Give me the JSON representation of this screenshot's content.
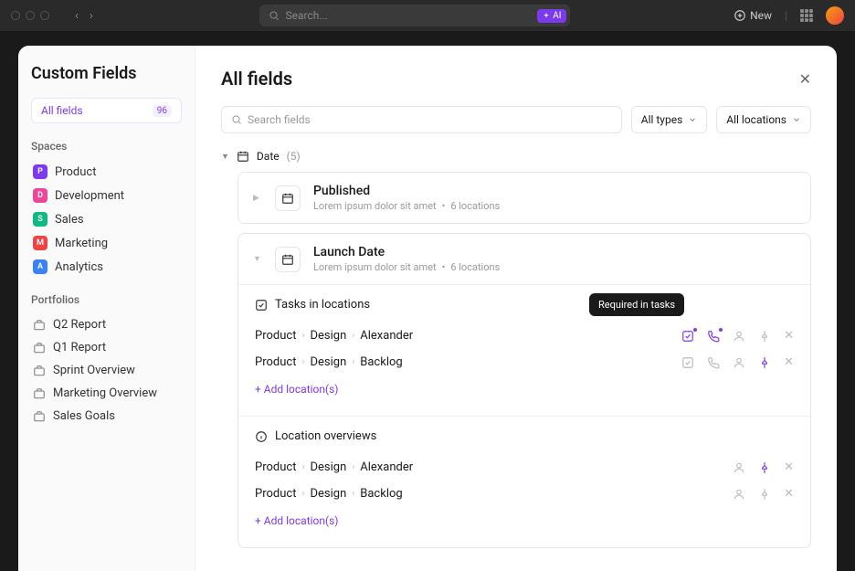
{
  "titlebar": {
    "search_placeholder": "Search...",
    "ai_label": "AI",
    "new_label": "New"
  },
  "sidebar": {
    "title": "Custom Fields",
    "all_fields_label": "All fields",
    "all_fields_count": "96",
    "spaces_label": "Spaces",
    "spaces": [
      {
        "letter": "P",
        "color": "#7c3aed",
        "name": "Product"
      },
      {
        "letter": "D",
        "color": "#ec4899",
        "name": "Development"
      },
      {
        "letter": "S",
        "color": "#10b981",
        "name": "Sales"
      },
      {
        "letter": "M",
        "color": "#ef4444",
        "name": "Marketing"
      },
      {
        "letter": "A",
        "color": "#3b82f6",
        "name": "Analytics"
      }
    ],
    "portfolios_label": "Portfolios",
    "portfolios": [
      {
        "name": "Q2 Report"
      },
      {
        "name": "Q1 Report"
      },
      {
        "name": "Sprint Overview"
      },
      {
        "name": "Marketing Overview"
      },
      {
        "name": "Sales Goals"
      }
    ]
  },
  "main": {
    "title": "All fields",
    "search_placeholder": "Search fields",
    "filter_types": "All types",
    "filter_locations": "All locations",
    "group": {
      "name": "Date",
      "count": "(5)"
    },
    "fields": [
      {
        "name": "Published",
        "desc": "Lorem ipsum dolor sit amet",
        "locations": "6 locations"
      },
      {
        "name": "Launch Date",
        "desc": "Lorem ipsum dolor sit amet",
        "locations": "6 locations"
      }
    ],
    "tasks_section": "Tasks in locations",
    "locations_section": "Location overviews",
    "tooltip": "Required in tasks",
    "task_rows": [
      {
        "segments": [
          "Product",
          "Design",
          "Alexander"
        ]
      },
      {
        "segments": [
          "Product",
          "Design",
          "Backlog"
        ]
      }
    ],
    "overview_rows": [
      {
        "segments": [
          "Product",
          "Design",
          "Alexander"
        ]
      },
      {
        "segments": [
          "Product",
          "Design",
          "Backlog"
        ]
      }
    ],
    "add_location": "+ Add location(s)"
  }
}
